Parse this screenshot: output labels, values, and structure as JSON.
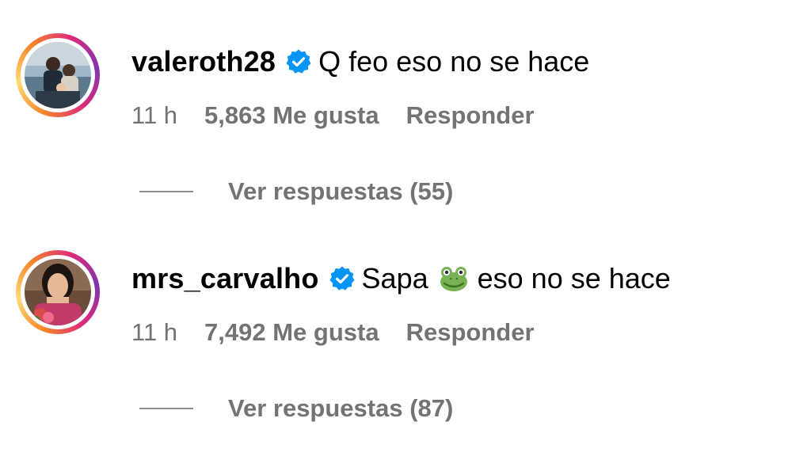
{
  "comments": [
    {
      "username": "valeroth28",
      "verified": true,
      "text": "Q feo eso no se hace",
      "time": "11 h",
      "likes": "5,863 Me gusta",
      "reply_label": "Responder",
      "view_replies": "Ver respuestas (55)"
    },
    {
      "username": "mrs_carvalho",
      "verified": true,
      "text_before_emoji": "Sapa",
      "emoji": "frog-emoji",
      "text_after_emoji": "eso no se hace",
      "time": "11 h",
      "likes": "7,492 Me gusta",
      "reply_label": "Responder",
      "view_replies": "Ver respuestas (87)"
    }
  ],
  "colors": {
    "text": "#000000",
    "meta": "#737373",
    "verified_badge": "#0095f6",
    "story_ring": [
      "#f58529",
      "#feda77",
      "#dd2a7b",
      "#8134af"
    ]
  }
}
